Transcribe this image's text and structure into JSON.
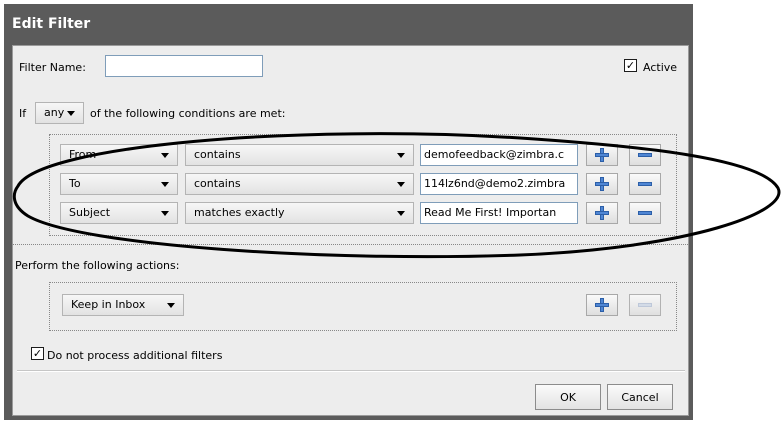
{
  "dialog": {
    "title": "Edit Filter"
  },
  "filter_name": {
    "label": "Filter Name:",
    "value": ""
  },
  "active": {
    "label": "Active",
    "checked": true
  },
  "conditions_line": {
    "if_label": "If",
    "match_value": "any",
    "suffix": "of the following conditions are met:"
  },
  "conditions": [
    {
      "field": "From",
      "operator": "contains",
      "value": "demofeedback@zimbra.c"
    },
    {
      "field": "To",
      "operator": "contains",
      "value": "114lz6nd@demo2.zimbra"
    },
    {
      "field": "Subject",
      "operator": "matches exactly",
      "value": "Read Me First! Importan"
    }
  ],
  "actions": {
    "label": "Perform the following actions:",
    "action_value": "Keep in Inbox"
  },
  "no_more_filters": {
    "label": "Do not process additional filters",
    "checked": true
  },
  "buttons": {
    "ok": "OK",
    "cancel": "Cancel"
  }
}
